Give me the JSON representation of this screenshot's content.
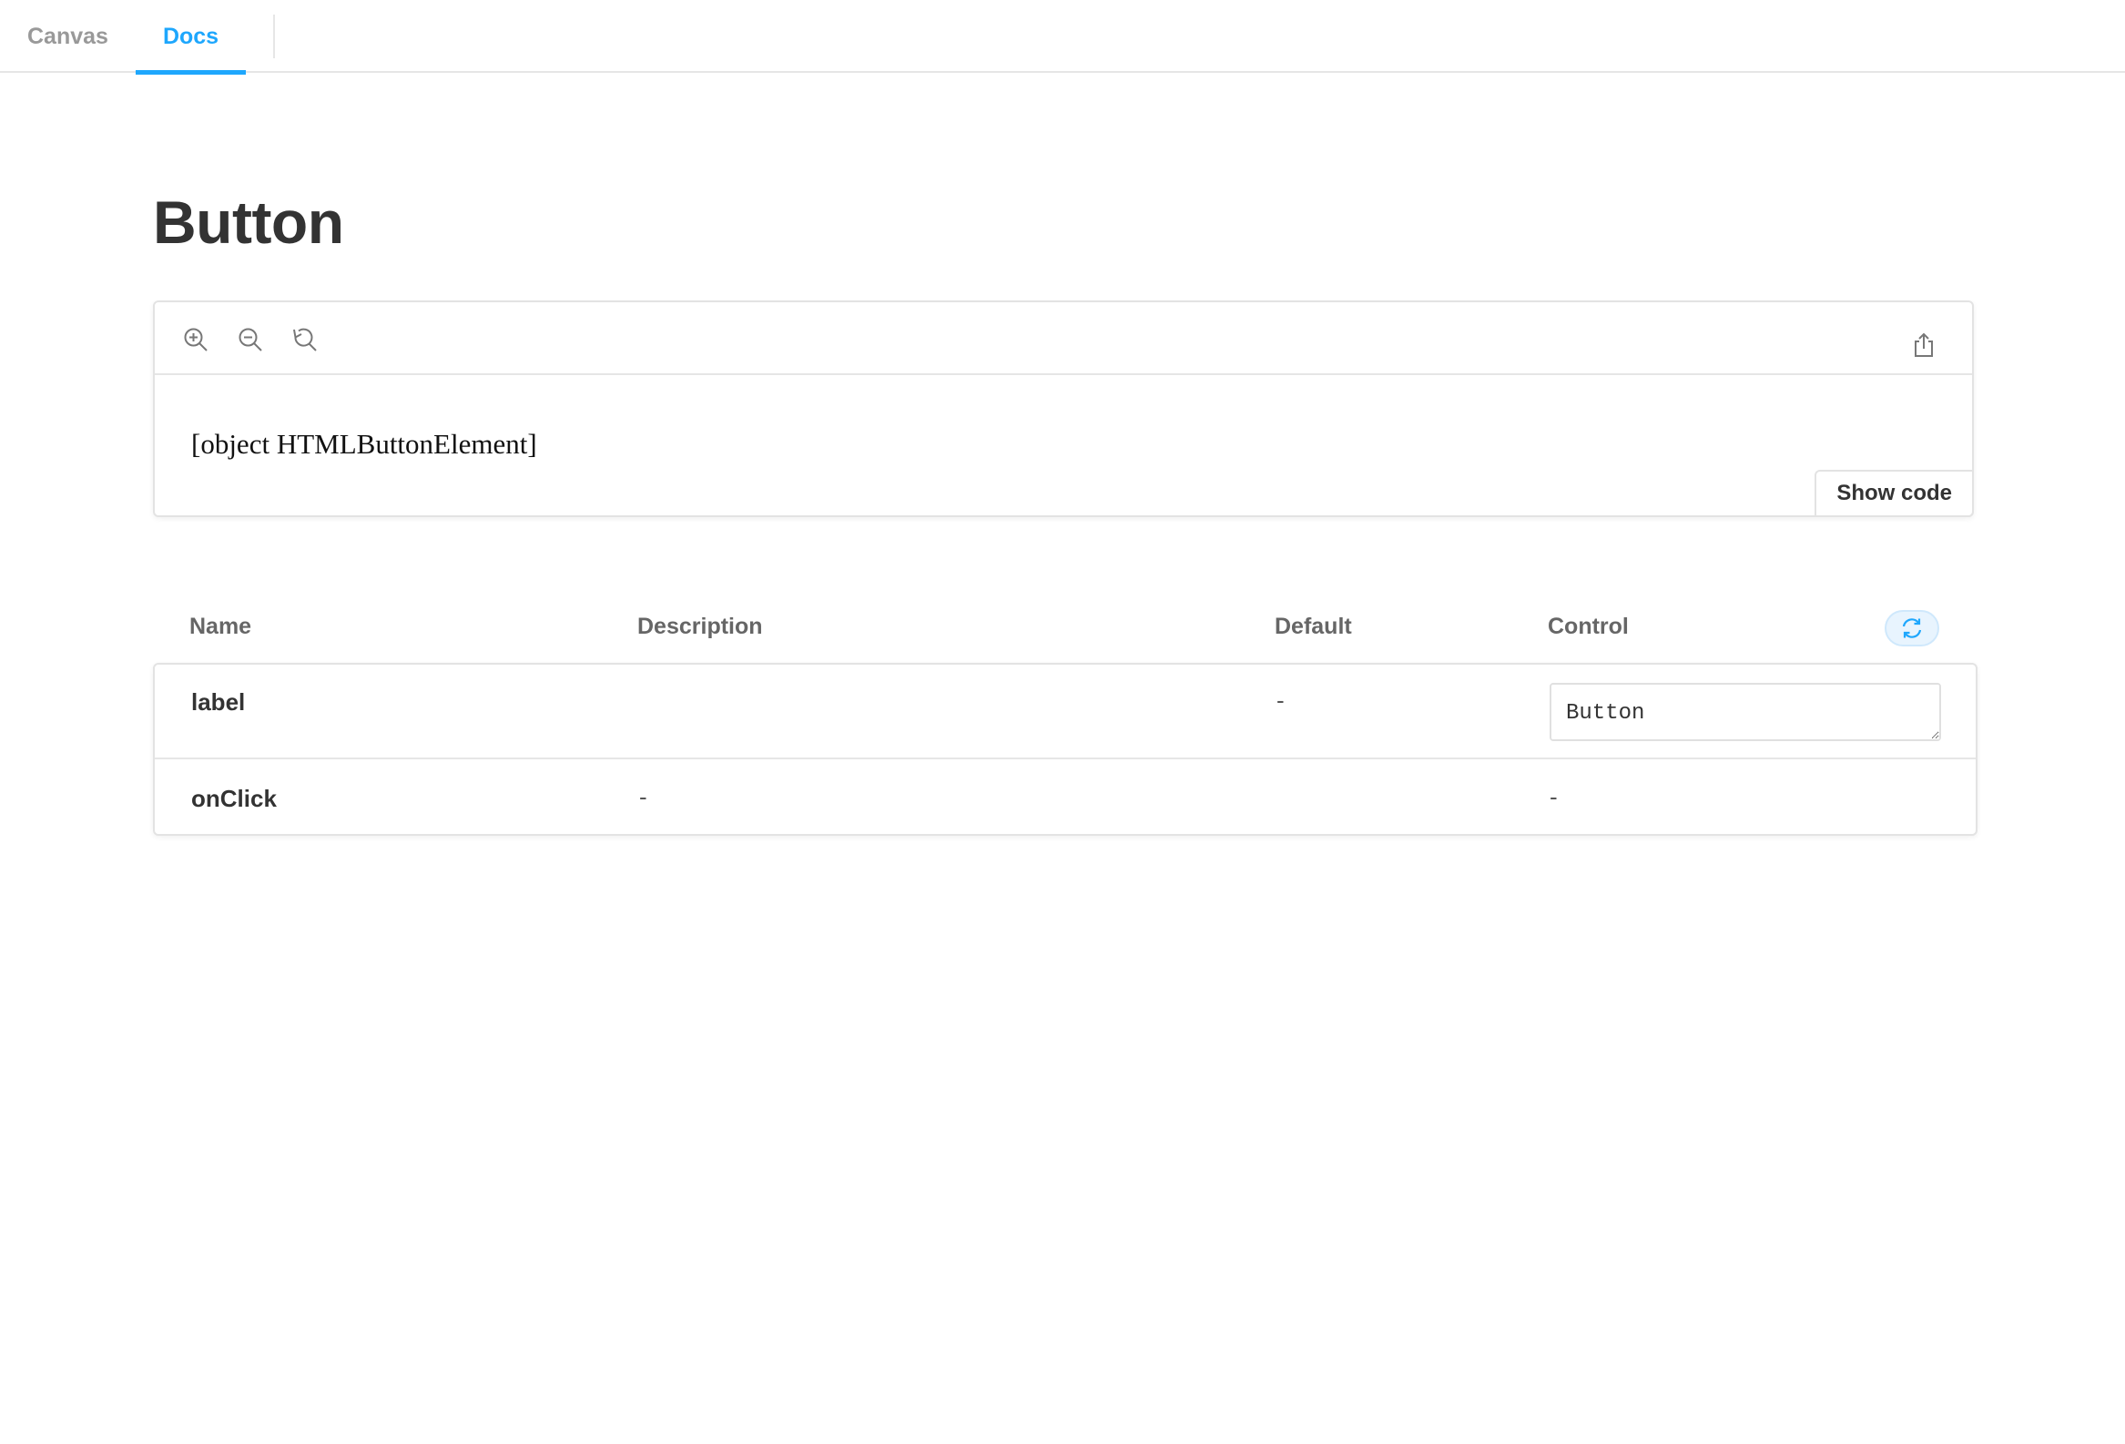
{
  "tabs": [
    {
      "label": "Canvas",
      "active": false
    },
    {
      "label": "Docs",
      "active": true
    }
  ],
  "page_title": "Button",
  "preview": {
    "toolbar": {
      "zoom_in_icon": "zoom-in-icon",
      "zoom_out_icon": "zoom-out-icon",
      "reset_zoom_icon": "reset-zoom-icon",
      "share_icon": "share-icon"
    },
    "content": "[object HTMLButtonElement]",
    "show_code_label": "Show code"
  },
  "args_table": {
    "headers": {
      "name": "Name",
      "description": "Description",
      "default": "Default",
      "control": "Control"
    },
    "reset_icon": "sync-icon",
    "rows": [
      {
        "name": "label",
        "description": "",
        "default": "-",
        "control_value": "Button"
      },
      {
        "name": "onClick",
        "description": "-",
        "default": "",
        "control": "-"
      }
    ]
  },
  "colors": {
    "accent": "#1ea7fd",
    "text": "#333333",
    "muted": "#999999",
    "border": "#e3e3e3"
  }
}
